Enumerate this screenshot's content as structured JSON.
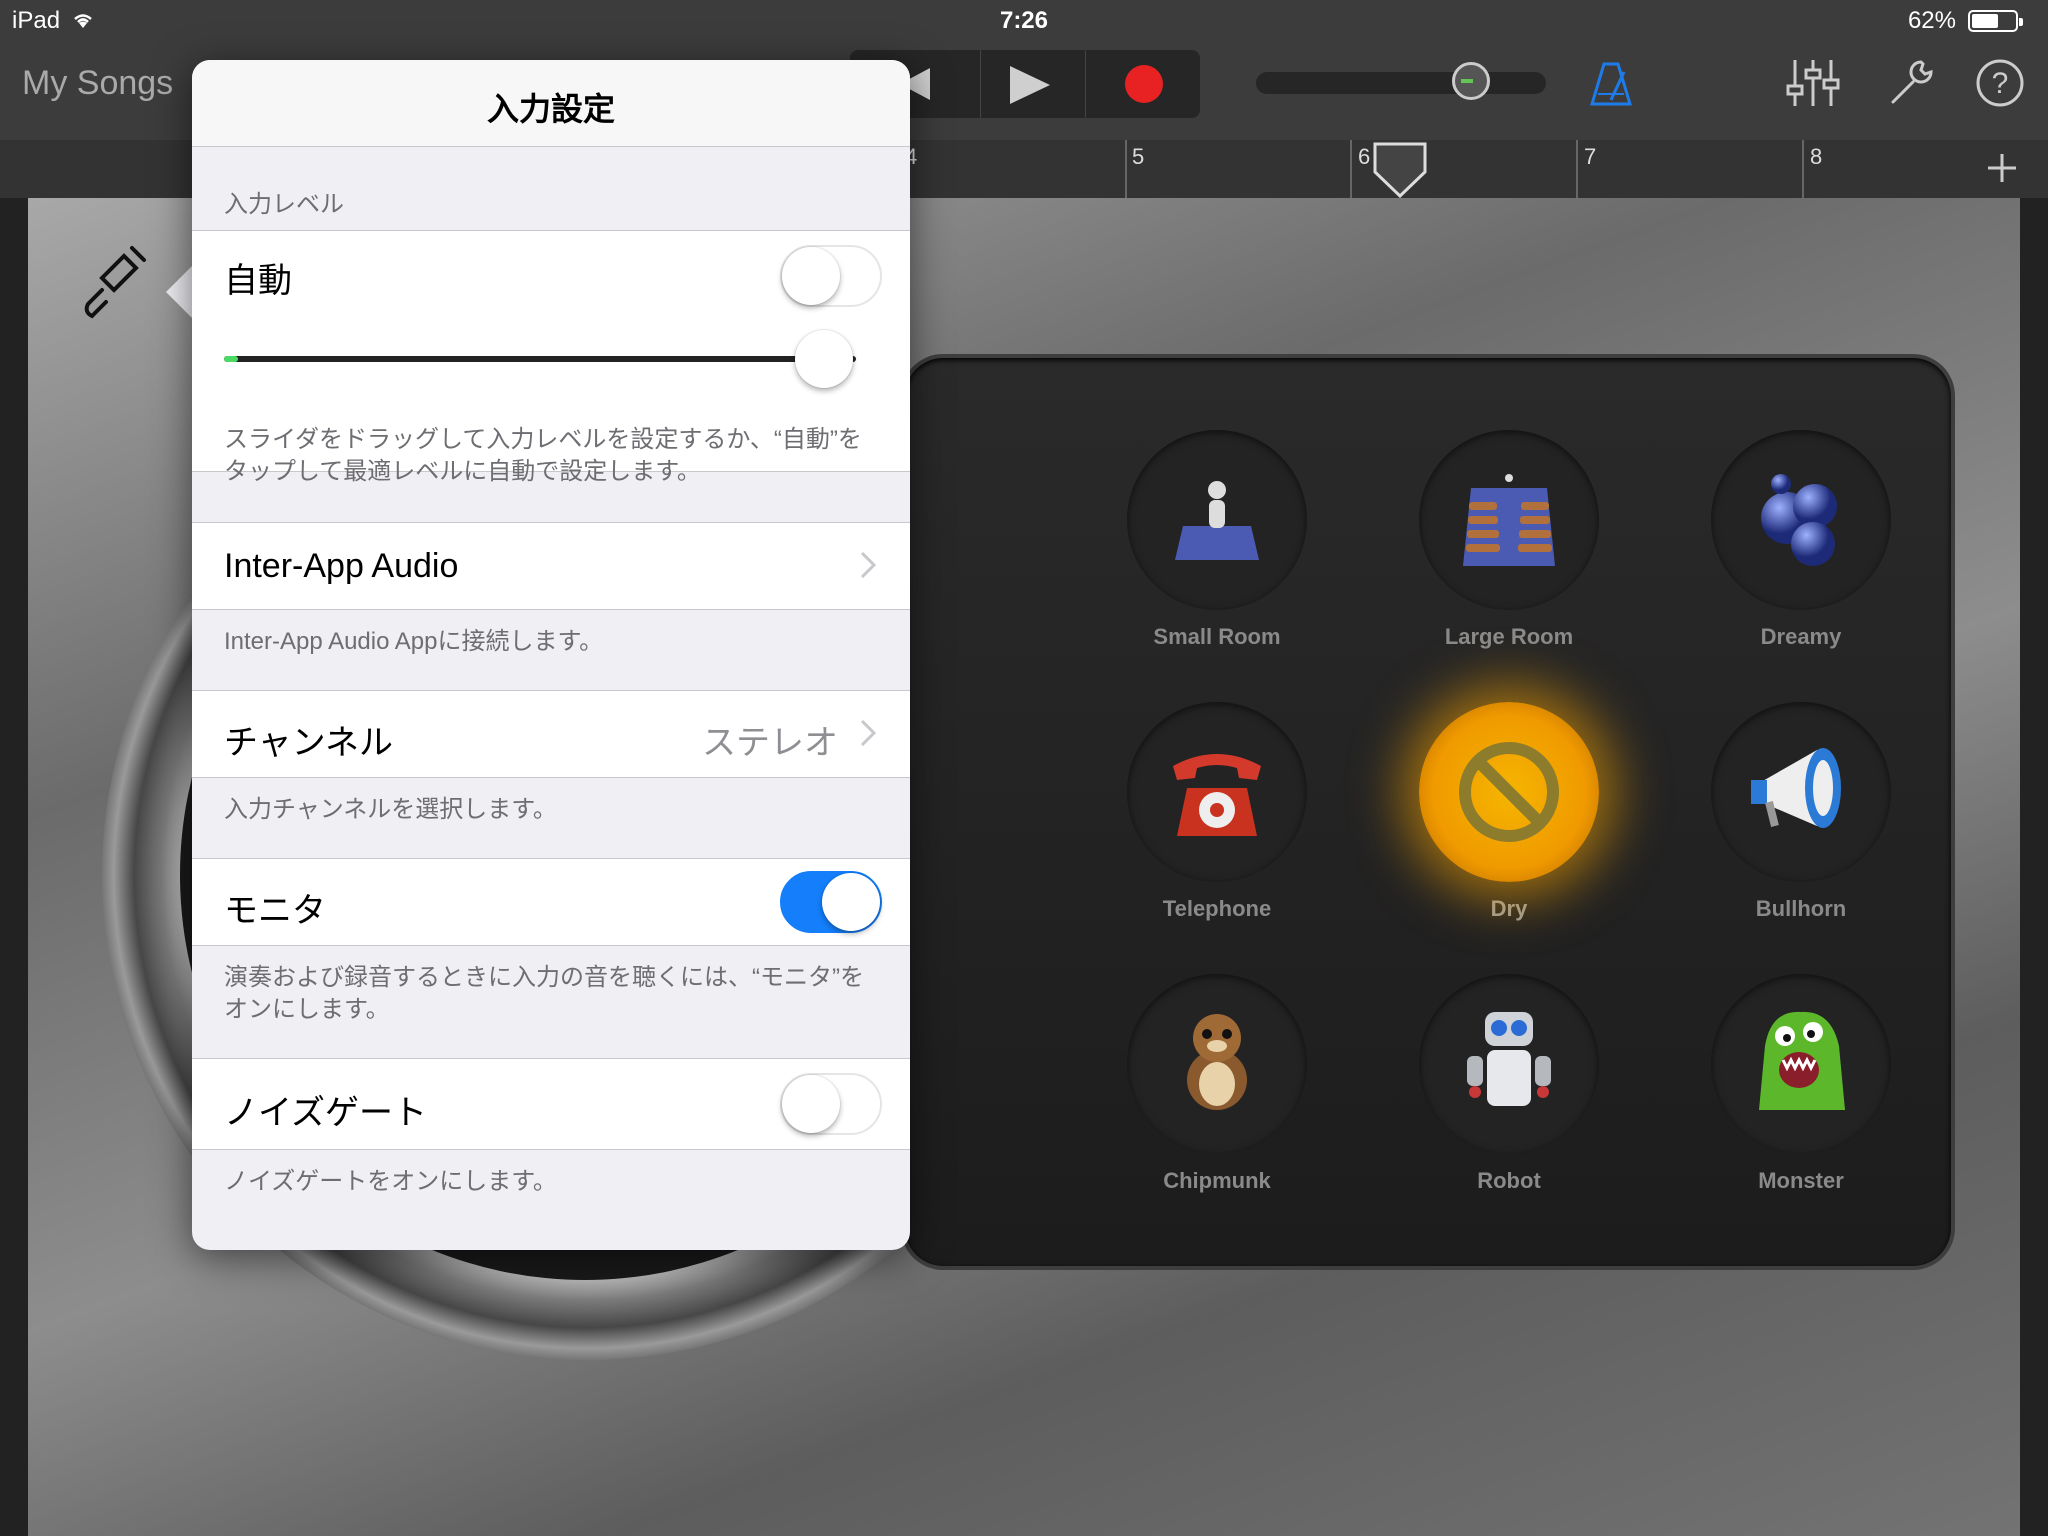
{
  "status_bar": {
    "carrier": "iPad",
    "time": "7:26",
    "battery": "62%",
    "battery_level": 0.62
  },
  "toolbar": {
    "my_songs": "My Songs"
  },
  "ruler": {
    "marks": [
      "4",
      "5",
      "6",
      "7",
      "8"
    ]
  },
  "popover": {
    "title": "入力設定",
    "input_level": {
      "header": "入力レベル",
      "auto_label": "自動",
      "auto_on": false,
      "level": 0.95,
      "footer": "スライダをドラッグして入力レベルを設定するか、“自動”をタップして最適レベルに自動で設定します。"
    },
    "inter_app": {
      "label": "Inter-App Audio",
      "footer": "Inter-App Audio Appに接続します。"
    },
    "channel": {
      "label": "チャンネル",
      "value": "ステレオ",
      "footer": "入力チャンネルを選択します。"
    },
    "monitor": {
      "label": "モニタ",
      "on": true,
      "footer": "演奏および録音するときに入力の音を聴くには、“モニタ”をオンにします。"
    },
    "noise_gate": {
      "label": "ノイズゲート",
      "on": false,
      "footer": "ノイズゲートをオンにします。"
    }
  },
  "effects": [
    {
      "name": "Small Room",
      "icon": "small-room-icon"
    },
    {
      "name": "Large Room",
      "icon": "large-room-icon"
    },
    {
      "name": "Dreamy",
      "icon": "bubbles-icon"
    },
    {
      "name": "Telephone",
      "icon": "telephone-icon"
    },
    {
      "name": "Dry",
      "icon": "no-effect-icon",
      "selected": true
    },
    {
      "name": "Bullhorn",
      "icon": "megaphone-icon"
    },
    {
      "name": "Chipmunk",
      "icon": "chipmunk-icon"
    },
    {
      "name": "Robot",
      "icon": "robot-icon"
    },
    {
      "name": "Monster",
      "icon": "monster-icon"
    }
  ],
  "colors": {
    "accent": "#147efb",
    "record": "#e82222",
    "level_green": "#4cd964",
    "dry_glow": "#f5a800"
  }
}
